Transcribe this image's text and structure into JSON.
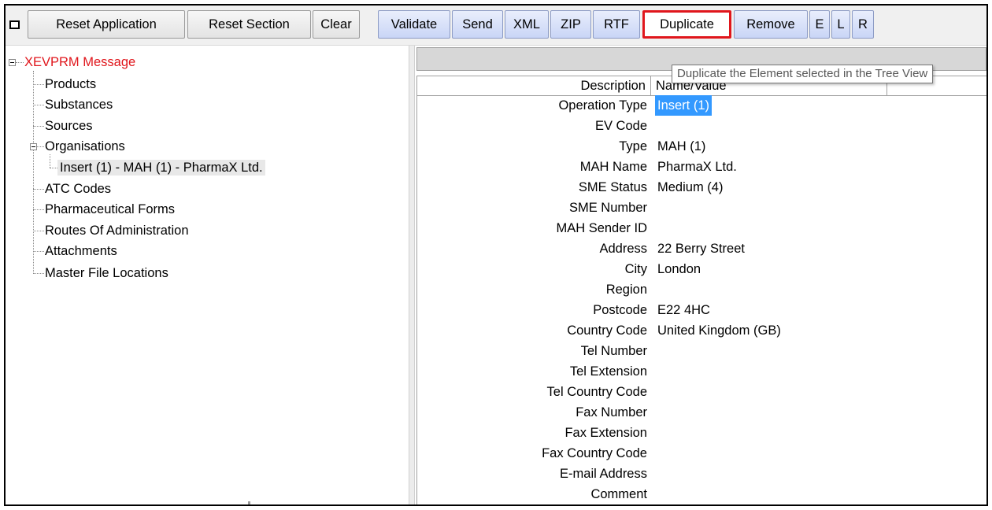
{
  "toolbar": {
    "collapse_label": "",
    "buttons": [
      {
        "label": "Reset Application",
        "style": "grey"
      },
      {
        "label": "Reset Section",
        "style": "grey"
      },
      {
        "label": "Clear",
        "style": "grey"
      },
      {
        "label": "Validate",
        "style": "blue"
      },
      {
        "label": "Send",
        "style": "blue"
      },
      {
        "label": "XML",
        "style": "blue"
      },
      {
        "label": "ZIP",
        "style": "blue"
      },
      {
        "label": "RTF",
        "style": "blue"
      },
      {
        "label": "Duplicate",
        "style": "highlight"
      },
      {
        "label": "Remove",
        "style": "blue"
      },
      {
        "label": "E",
        "style": "blue"
      },
      {
        "label": "L",
        "style": "blue"
      },
      {
        "label": "R",
        "style": "blue"
      }
    ]
  },
  "tooltip": "Duplicate the Element selected in the Tree View",
  "tree": {
    "root": "XEVPRM Message",
    "items": [
      {
        "label": "Products"
      },
      {
        "label": "Substances"
      },
      {
        "label": "Sources"
      },
      {
        "label": "Organisations",
        "expanded": true
      },
      {
        "label": "Insert (1) - MAH (1) - PharmaX Ltd.",
        "selected": true
      },
      {
        "label": "ATC Codes"
      },
      {
        "label": "Pharmaceutical Forms"
      },
      {
        "label": "Routes Of Administration"
      },
      {
        "label": "Attachments"
      },
      {
        "label": "Master File Locations"
      }
    ]
  },
  "grid": {
    "headers": {
      "description": "Description",
      "name_value": "Name/Value"
    },
    "rows": [
      {
        "label": "Operation Type",
        "value": "Insert (1)",
        "selected": true
      },
      {
        "label": "EV Code",
        "value": ""
      },
      {
        "label": "Type",
        "value": "MAH (1)"
      },
      {
        "label": "MAH Name",
        "value": "PharmaX Ltd."
      },
      {
        "label": "SME Status",
        "value": "Medium (4)"
      },
      {
        "label": "SME Number",
        "value": ""
      },
      {
        "label": "MAH Sender ID",
        "value": ""
      },
      {
        "label": "Address",
        "value": "22 Berry Street"
      },
      {
        "label": "City",
        "value": "London"
      },
      {
        "label": "Region",
        "value": ""
      },
      {
        "label": "Postcode",
        "value": "E22 4HC"
      },
      {
        "label": "Country Code",
        "value": "United Kingdom (GB)"
      },
      {
        "label": "Tel Number",
        "value": ""
      },
      {
        "label": "Tel Extension",
        "value": ""
      },
      {
        "label": "Tel Country Code",
        "value": ""
      },
      {
        "label": "Fax Number",
        "value": ""
      },
      {
        "label": "Fax Extension",
        "value": ""
      },
      {
        "label": "Fax Country Code",
        "value": ""
      },
      {
        "label": "E-mail Address",
        "value": ""
      },
      {
        "label": "Comment",
        "value": ""
      }
    ]
  },
  "colors": {
    "root_text": "#e0161c",
    "highlight_border": "#e0161c",
    "selection": "#3399ff"
  }
}
